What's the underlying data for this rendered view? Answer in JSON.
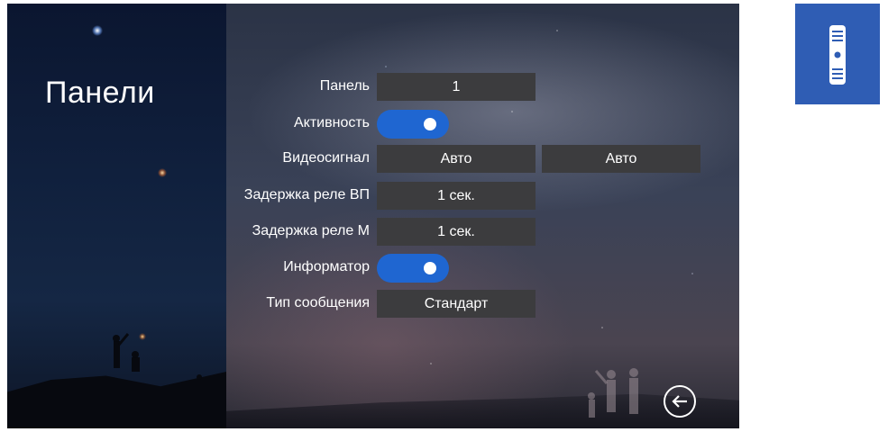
{
  "page_title": "Панели",
  "rows": [
    {
      "label": "Панель",
      "type": "value",
      "value": "1"
    },
    {
      "label": "Активность",
      "type": "toggle",
      "on": true
    },
    {
      "label": "Видеосигнал",
      "type": "value",
      "value": "Авто",
      "value2": "Авто"
    },
    {
      "label": "Задержка реле ВП",
      "type": "value",
      "value": "1 сек."
    },
    {
      "label": "Задержка реле М",
      "type": "value",
      "value": "1 сек."
    },
    {
      "label": "Информатор",
      "type": "toggle",
      "on": true
    },
    {
      "label": "Тип сообщения",
      "type": "value",
      "value": "Стандарт"
    }
  ],
  "icons": {
    "back": "back-arrow-icon",
    "device": "door-panel-icon"
  },
  "colors": {
    "toggle_on": "#1f66d1",
    "value_box": "#3c3c3e",
    "device_tile": "#2f5db4"
  }
}
